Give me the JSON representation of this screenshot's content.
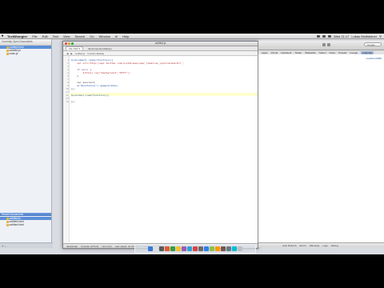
{
  "menubar": {
    "apple": "",
    "items": [
      "TextWrangler",
      "File",
      "Edit",
      "Text",
      "View",
      "Search",
      "Go",
      "Window",
      "#!",
      "Help"
    ],
    "clock": "Wed 21:17",
    "user": "Lukas Wolfsteiner"
  },
  "sidebar": {
    "header": "Currently Open Documents",
    "items": [
      "untitled.html",
      "untitled.js",
      "node.js"
    ],
    "selected_index": 0,
    "section_label": "Recent Documents",
    "recent": [
      "untitled.js",
      "untitled.html",
      "untitled.html"
    ],
    "add_label": "+",
    "remove_label": "-"
  },
  "editor": {
    "title": "untitled.js",
    "tabs": [
      "File Path ▾",
      "/Documents/untitled.js"
    ],
    "nav": [
      "untitled.js",
      "function $(data)"
    ],
    "lines": [
      {
        "n": "1",
        "text": "$(document).ready(function(){",
        "cls": "c-fn"
      },
      {
        "n": "2",
        "text": "    var url='http://api.twitter.com/1/statuses/user_timeline.json?callback=?';",
        "cls": "c-str"
      },
      {
        "n": "3",
        "text": "",
        "cls": ""
      },
      {
        "n": "4",
        "text": "    if (err) {",
        "cls": "c-kw"
      },
      {
        "n": "5",
        "text": "        $(this).css(\"background\",\"#fff\");",
        "cls": "c-str"
      },
      {
        "n": "6",
        "text": "    }",
        "cls": ""
      },
      {
        "n": "7",
        "text": "",
        "cls": ""
      },
      {
        "n": "8",
        "text": "    var source=1;",
        "cls": ""
      },
      {
        "n": "9",
        "text": "    $(\"#container\").append(data);",
        "cls": "c-fn"
      },
      {
        "n": "10",
        "text": "});",
        "cls": ""
      },
      {
        "n": "11",
        "text": "",
        "cls": ""
      },
      {
        "n": "12",
        "text": "$(window).load(function(){",
        "cls": "c-fn"
      },
      {
        "n": "13",
        "text": "",
        "cls": ""
      },
      {
        "n": "14",
        "text": "});",
        "cls": ""
      }
    ],
    "status": [
      "JavaScript",
      "Unicode (UTF-8)",
      "Unix (LF)",
      "Last saved: 21.03.2012 21:16:55",
      "14 / 133 / 14"
    ]
  },
  "browser": {
    "search_placeholder": "Google",
    "bookmarks": [
      "Apple",
      "iCloud",
      "Facebook",
      "Twitter",
      "Wikipedia",
      "Yahoo!",
      "News",
      "Popular",
      "Google",
      "Calendar"
    ],
    "active_bookmark": 9,
    "page_link": "localhost:8080",
    "status": [
      "Auto Refresh",
      "Errors",
      "Warnings",
      "Logs",
      "Debug"
    ]
  },
  "colors": {
    "selection": "#5b8fd8",
    "current_line": "#ffffcf",
    "link": "#2a5db0"
  },
  "dock": {
    "apps": [
      "#3a7bd5",
      "#e0e0e0",
      "#5a5a5a",
      "#e05a2a",
      "#3b9c3b",
      "#f2c12e",
      "#9b59b6",
      "#2ea3d5",
      "#d64545",
      "#6b6b6b",
      "#2f80ed",
      "#8bc34a",
      "#ff9800",
      "#795548",
      "#607d8b",
      "#00bcd4",
      "#c0c0c0"
    ]
  }
}
